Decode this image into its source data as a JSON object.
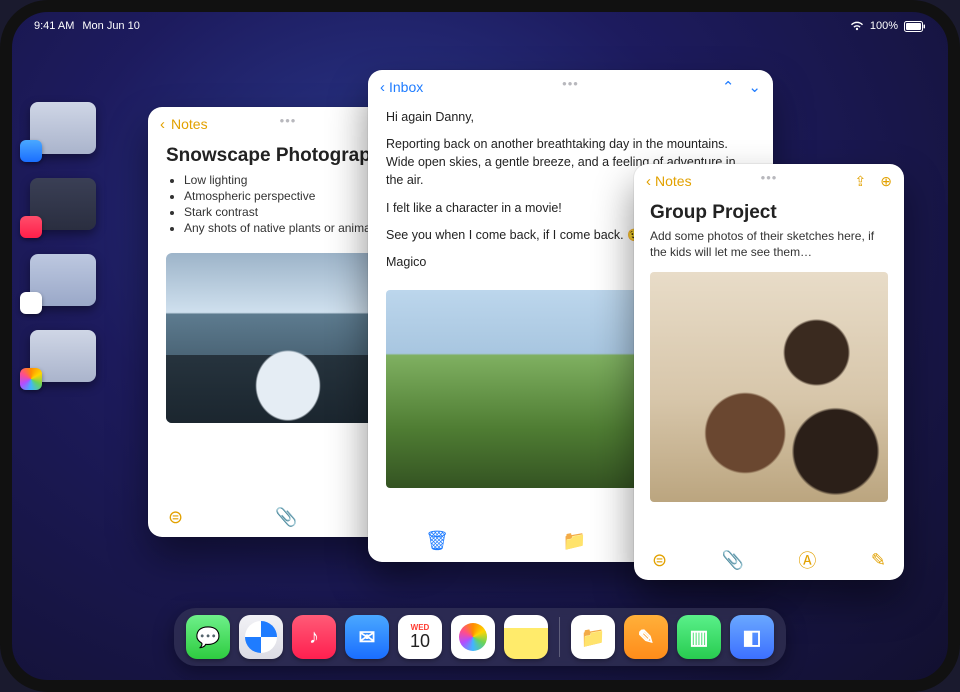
{
  "statusbar": {
    "time": "9:41 AM",
    "date": "Mon Jun 10",
    "battery": "100%"
  },
  "dock": {
    "calendar_weekday": "WED",
    "calendar_day": "10"
  },
  "notes1": {
    "back_label": "Notes",
    "title": "Snowscape Photography",
    "bullets": [
      "Low lighting",
      "Atmospheric perspective",
      "Stark contrast",
      "Any shots of native plants or animals"
    ]
  },
  "mail": {
    "back_label": "Inbox",
    "greeting": "Hi again Danny,",
    "para1": "Reporting back on another breathtaking day in the mountains. Wide open skies, a gentle breeze, and a feeling of adventure in the air.",
    "para2": "I felt like a character in a movie!",
    "para3_prefix": "See you when I come back, if I come back. ",
    "emoji": "😉",
    "signoff": "Magico"
  },
  "notes2": {
    "back_label": "Notes",
    "title": "Group Project",
    "subtext": "Add some photos of their sketches here, if the kids will let me see them…"
  }
}
